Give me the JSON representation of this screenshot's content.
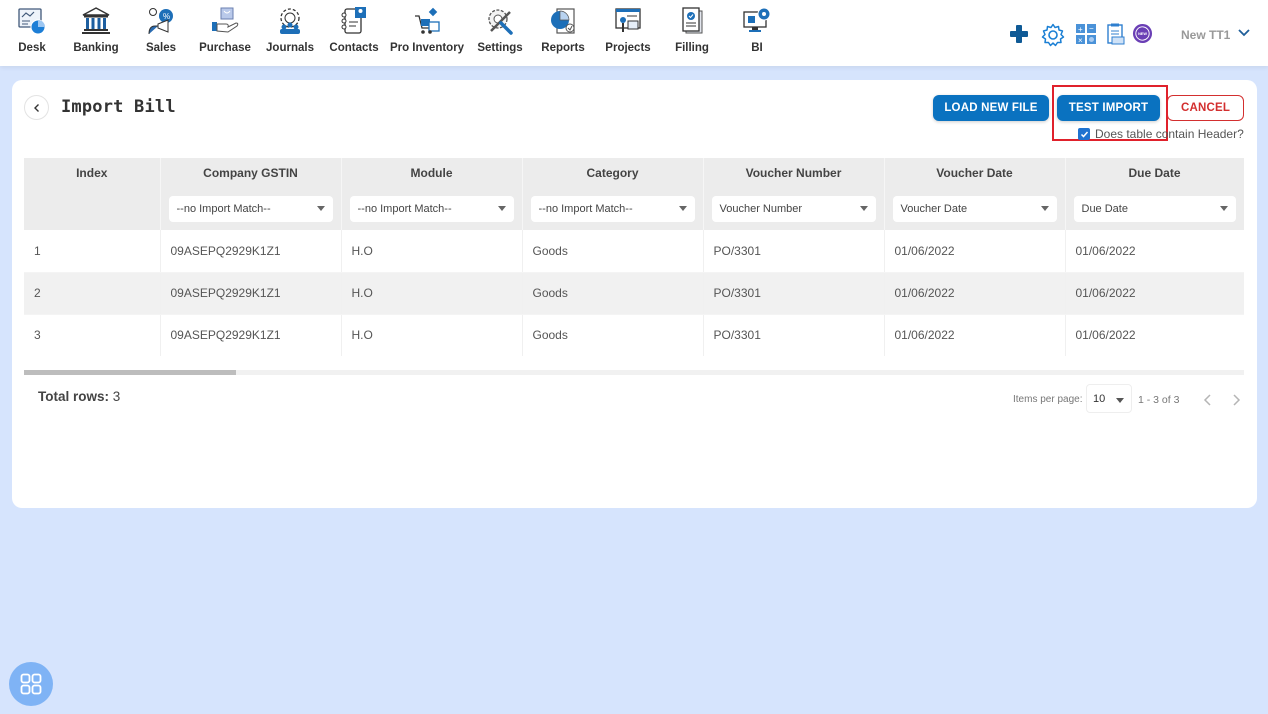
{
  "nav": {
    "items": [
      {
        "label": "Desk",
        "icon": "desk-icon"
      },
      {
        "label": "Banking",
        "icon": "bank-icon"
      },
      {
        "label": "Sales",
        "icon": "sales-icon"
      },
      {
        "label": "Purchase",
        "icon": "purchase-icon"
      },
      {
        "label": "Journals",
        "icon": "journals-icon"
      },
      {
        "label": "Contacts",
        "icon": "contacts-icon"
      },
      {
        "label": "Pro Inventory",
        "icon": "inventory-icon"
      },
      {
        "label": "Settings",
        "icon": "settings-tools-icon"
      },
      {
        "label": "Reports",
        "icon": "reports-icon"
      },
      {
        "label": "Projects",
        "icon": "projects-icon"
      },
      {
        "label": "Filling",
        "icon": "filling-icon"
      },
      {
        "label": "BI",
        "icon": "bi-icon"
      }
    ],
    "actions": [
      "plus-icon",
      "gear-icon",
      "calculator-icon",
      "notes-icon",
      "new-badge-icon"
    ],
    "user_name": "New TT1"
  },
  "page": {
    "title": "Import Bill",
    "buttons": {
      "load_new_file": "LOAD NEW FILE",
      "test_import": "TEST IMPORT",
      "cancel": "CANCEL"
    },
    "header_checkbox": {
      "label": "Does table contain Header?",
      "checked": true
    }
  },
  "table": {
    "columns": [
      "Index",
      "Company GSTIN",
      "Module",
      "Category",
      "Voucher Number",
      "Voucher Date",
      "Due Date"
    ],
    "mappings": [
      "",
      "--no Import Match--",
      "--no Import Match--",
      "--no Import Match--",
      "Voucher Number",
      "Voucher Date",
      "Due Date"
    ],
    "rows": [
      [
        "1",
        "09ASEPQ2929K1Z1",
        "H.O",
        "Goods",
        "PO/3301",
        "01/06/2022",
        "01/06/2022"
      ],
      [
        "2",
        "09ASEPQ2929K1Z1",
        "H.O",
        "Goods",
        "PO/3301",
        "01/06/2022",
        "01/06/2022"
      ],
      [
        "3",
        "09ASEPQ2929K1Z1",
        "H.O",
        "Goods",
        "PO/3301",
        "01/06/2022",
        "01/06/2022"
      ]
    ]
  },
  "footer": {
    "total_rows_label": "Total rows:",
    "total_rows_value": "3",
    "items_per_page_label": "Items per page:",
    "items_per_page_value": "10",
    "range_label": "1 - 3 of 3"
  },
  "colors": {
    "primary": "#0a72c0",
    "danger": "#d32f2f",
    "highlight": "#e0212b",
    "background": "#d6e4fd"
  }
}
